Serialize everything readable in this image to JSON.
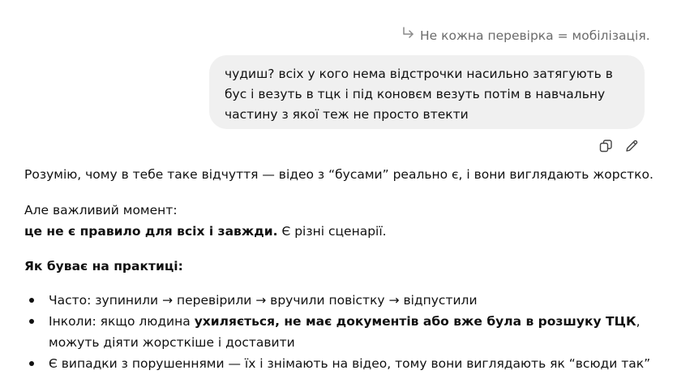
{
  "reply_quote": {
    "icon": "reply-arrow-icon",
    "text": "Не кожна перевірка = мобілізація."
  },
  "user_message": {
    "text": "чудиш? всіх у кого нема відстрочки насильно затягують в бус і везуть в тцк і під коновєм везуть потім в навчальну частину з якої теж не просто втекти"
  },
  "message_actions": {
    "copy_icon": "copy-icon",
    "edit_icon": "pencil-edit-icon"
  },
  "assistant_message": {
    "intro": "Розумію, чому в тебе таке відчуття — відео з “бусами” реально є, і вони виглядають жорстко.",
    "important_line1": "Але важливий момент:",
    "important_bold": "це не є правило для всіх і завжди.",
    "important_rest": " Є різні сценарії.",
    "practice_heading": "Як буває на практиці:",
    "bullets": [
      {
        "text": "Часто: зупинили → перевірили → вручили повістку → відпустили"
      },
      {
        "prefix": "Інколи: якщо людина ",
        "bold": "ухиляється, не має документів або вже була в розшуку ТЦК",
        "suffix": ", можуть діяти жорсткіше і доставити"
      },
      {
        "text": "Є випадки з порушеннями — їх і знімають на відео, тому вони виглядають як “всюди так”"
      }
    ]
  }
}
